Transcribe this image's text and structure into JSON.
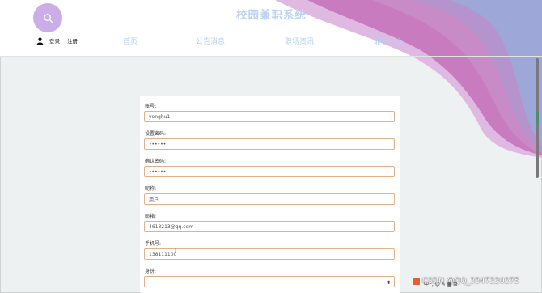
{
  "header": {
    "site_title": "校园兼职系统",
    "login_label": "登录",
    "register_label": "注册",
    "nav": [
      "首页",
      "公告消息",
      "职场资讯",
      "兼职中心"
    ]
  },
  "form": {
    "fields": [
      {
        "label": "账号:",
        "value": "yonghu1"
      },
      {
        "label": "设置密码:",
        "value": "••••••"
      },
      {
        "label": "确认密码:",
        "value": "••••••"
      },
      {
        "label": "昵称:",
        "value": "用户"
      },
      {
        "label": "邮箱:",
        "value": "4613213@qq.com"
      },
      {
        "label": "手机号:",
        "value": "138111100"
      },
      {
        "label": "身份:",
        "value": ""
      }
    ]
  },
  "watermark": {
    "text": "CSDN @QQ_3347220275",
    "toolbar": "中 ·, ☺ ✎ ▦ ⊞"
  },
  "colors": {
    "accent_purple": "#cbaee9",
    "nav_blue": "#b7cdee",
    "input_border": "#e3b08a"
  }
}
